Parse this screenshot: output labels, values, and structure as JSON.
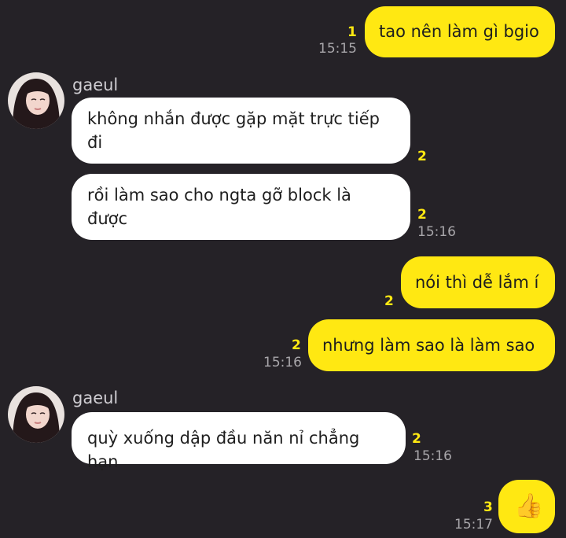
{
  "conversation": {
    "messages": [
      {
        "text": "tao nên làm gì bgio",
        "unread": "1",
        "time": "15:15"
      },
      {
        "text": "không nhắn được gặp mặt trực tiếp\nđi",
        "unread": "2"
      },
      {
        "text": "rồi làm sao cho ngta gỡ block là\nđược",
        "unread": "2",
        "time": "15:16"
      },
      {
        "text": "nói thì dễ lắm í",
        "unread": "2"
      },
      {
        "text": "nhưng làm sao là làm sao",
        "unread": "2",
        "time": "15:16"
      },
      {
        "text": "quỳ xuống dập đầu năn nỉ chẳng hạn",
        "unread": "2",
        "time": "15:16"
      },
      {
        "text": "👍",
        "unread": "3",
        "time": "15:17"
      }
    ],
    "senders": [
      {
        "name": "gaeul"
      },
      {
        "name": "gaeul"
      }
    ]
  },
  "colors": {
    "background": "#252227",
    "my_bubble": "#ffe812",
    "their_bubble": "#ffffff",
    "unread_count": "#ffe812",
    "timestamp": "#a8a6aa"
  },
  "icons": {
    "reaction": "thumbs-up-icon"
  }
}
